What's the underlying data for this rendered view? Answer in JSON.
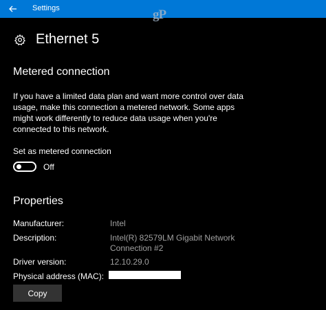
{
  "window": {
    "title": "Settings",
    "watermark": "gP",
    "accent_color": "#0078d7",
    "back_icon": "back-arrow-icon"
  },
  "page": {
    "title": "Ethernet 5",
    "icon": "gear-icon"
  },
  "metered": {
    "heading": "Metered connection",
    "description": "If you have a limited data plan and want more control over data usage, make this connection a metered network. Some apps might work differently to reduce data usage when you're connected to this network.",
    "toggle_label": "Set as metered connection",
    "toggle_state": "Off",
    "toggle_on": false
  },
  "properties": {
    "heading": "Properties",
    "manufacturer_label": "Manufacturer:",
    "manufacturer_value": "Intel",
    "description_label": "Description:",
    "description_value": "Intel(R) 82579LM Gigabit Network Connection #2",
    "driver_label": "Driver version:",
    "driver_value": "12.10.29.0",
    "mac_label": "Physical address (MAC):",
    "copy_label": "Copy"
  }
}
